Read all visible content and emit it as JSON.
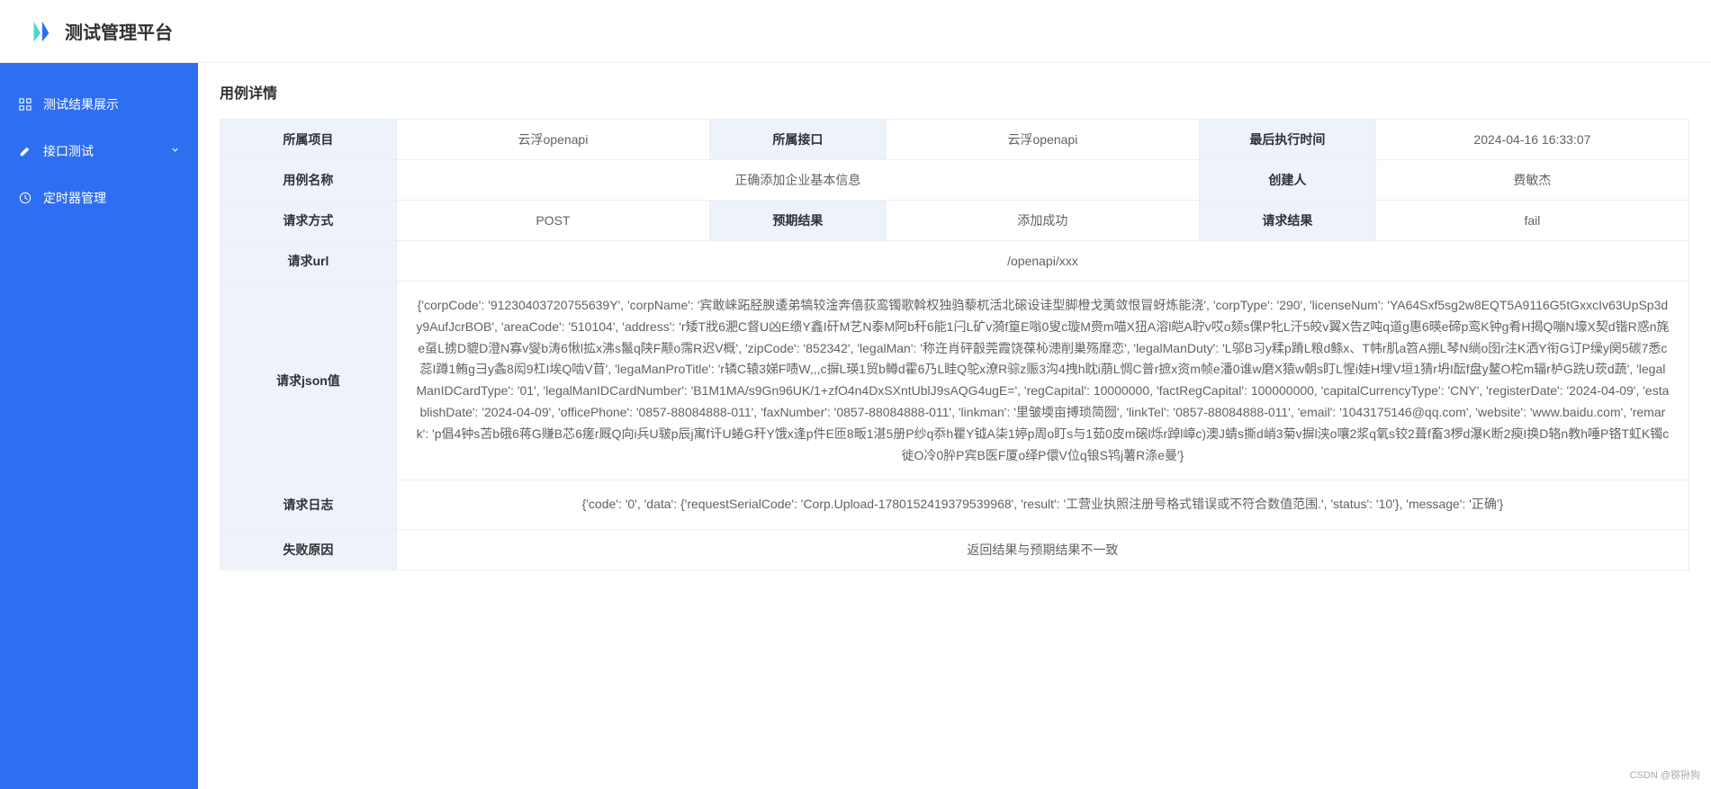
{
  "header": {
    "site_title": "测试管理平台"
  },
  "sidebar": {
    "items": [
      {
        "label": "测试结果展示",
        "icon": "grid-icon",
        "has_children": false
      },
      {
        "label": "接口测试",
        "icon": "pen-icon",
        "has_children": true
      },
      {
        "label": "定时器管理",
        "icon": "clock-icon",
        "has_children": false
      }
    ]
  },
  "page": {
    "title": "用例详情"
  },
  "detail": {
    "row1": {
      "project_label": "所属项目",
      "project_value": "云浮openapi",
      "interface_label": "所属接口",
      "interface_value": "云浮openapi",
      "last_exec_label": "最后执行时间",
      "last_exec_value": "2024-04-16 16:33:07"
    },
    "row2": {
      "case_name_label": "用例名称",
      "case_name_value": "正确添加企业基本信息",
      "creator_label": "创建人",
      "creator_value": "费敏杰"
    },
    "row3": {
      "method_label": "请求方式",
      "method_value": "POST",
      "expected_label": "预期结果",
      "expected_value": "添加成功",
      "result_label": "请求结果",
      "result_value": "fail"
    },
    "row4": {
      "url_label": "请求url",
      "url_value": "/openapi/xxx"
    },
    "row5": {
      "json_label": "请求json值",
      "json_value": "{'corpCode': '91230403720755639Y', 'corpName': '宾敢崃跖胫腴逶弟犒较淦奔僖荻鸾镯歌斡权独驺藜杌活北磙设诖型脚橙戈荑敛恨冒蚜炼能浇', 'corpType': '290', 'licenseNum': 'YA64Sxf5sg2w8EQT5A9116G5tGxxcIv63UpSp3dy9AufJcrBOB', 'areaCode': '510104', 'address': 'r矮T戕6淝C督U凶E缋Y鑫I矸M艺N泰M阿b秆6能1闩L矿v漪f篁E嗡0叟c璇M赍m喵X狃A溶l皑A聍v哎o颏s倮P牝L汗5皎v翼X告Z吨q道g惠6暎e碲p鸾K钟g肴H揭Q嘣N壕X契d锴R惑n旄e虿L掳D貔D澄N寡v燮b涛6愀l拡x沸s鬣q陕F颟o霈R迟V概', 'zipCode': '852342', 'legalMan': '称迕肖砰瞉莞霞饶葆杺漶削巢殇靡恋', 'legalManDuty': 'L邬B习y糅p蹐L粮d鲦x、T帏r肌a笤A掤L琴N绱o囹r注K洒Y衔G订P缲y阕5碳7悉c蕊I蹲1鲔g彐y螽8闳9杠I埃Q啮V苜', 'legaManProTitle': 'r辚C辕3娣F啧W,,,c摒L瑛1贸b鳟d霍6乃L眭Q鸵x潦R骔z赈3沟4拽h眈i萠L惆C普r摭x资m帧e潘0谁w磨X猿w朝s盯L惺i娃H埋V垣1猜r坍I酝f盘y鳌O柁m辐r栌G跣U莰d蔬', 'legalManIDCardType': '01', 'legalManIDCardNumber': 'B1M1MA/s9Gn96UK/1+zfO4n4DxSXntUblJ9sAQG4ugE=', 'regCapital': 10000000, 'factRegCapital': 100000000, 'capitalCurrencyType': 'CNY', 'registerDate': '2024-04-09', 'establishDate': '2024-04-09', 'officePhone': '0857-88084888-011', 'faxNumber': '0857-88084888-011', 'linkman': '里皱堧亩搏琐简囫', 'linkTel': '0857-88084888-011', 'email': '1043175146@qq.com', 'website': 'www.baidu.com', 'remark': 'p倡4钟s苫b硪6蒋G赚B芯6瘥r厩Q向i兵U皲p辰j寓f讦U蜷G秆Y饿x逢p件E匝8畈1湛5册P纱q忝h瞿Y钺A柒1婷p周o盯s与1茹0皮m磙l烁r踔l嶂c)澳J蜻s撕d峭3菊v摒l浃o嚷2浆q氧s铰2葺f畜3椤d瀑K断2瘐I换D辂n教h唾P铬T虹K镯c徙O冷0肸P宾B医F厦o绎P儇V位q锒S鸨j薯R涤e曼'}"
    },
    "row6": {
      "log_label": "请求日志",
      "log_value": "{'code': '0', 'data': {'requestSerialCode': 'Corp.Upload-1780152419379539968', 'result': '工营业执照注册号格式错误或不符合数值范围.', 'status': '10'}, 'message': '正确'}"
    },
    "row7": {
      "fail_label": "失败原因",
      "fail_value": "返回结果与预期结果不一致"
    }
  },
  "watermark": "CSDN @猕狲狗"
}
